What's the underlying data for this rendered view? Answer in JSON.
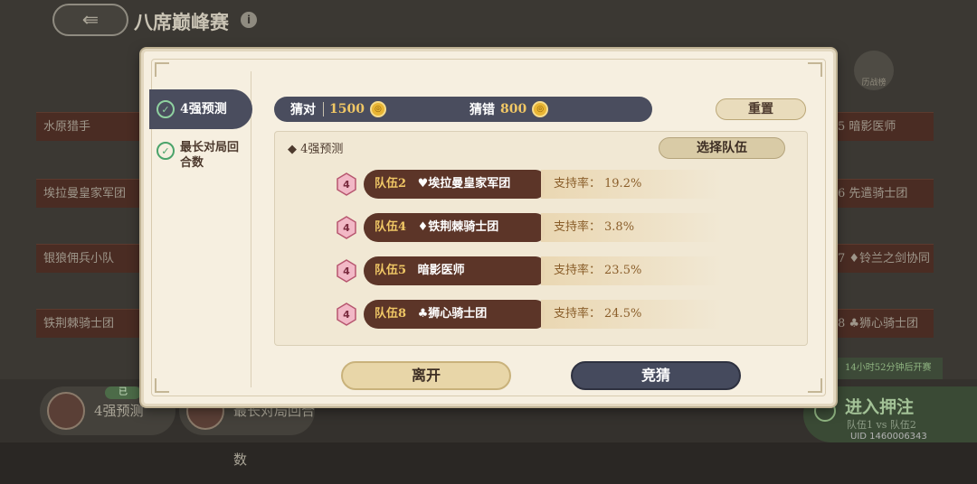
{
  "header": {
    "title": "八席巅峰赛",
    "back_icon": "⇚",
    "info_icon": "i"
  },
  "background": {
    "left_rows": [
      "水原猎手",
      "埃拉曼皇家军团",
      "银狼佣兵小队",
      "铁荆棘骑士团"
    ],
    "right_rows": [
      "5 暗影医师",
      "6 先遣骑士团",
      "7 ♦铃兰之剑协同",
      "8 ♣狮心骑士团"
    ],
    "ribbon_label": "历战榜",
    "countdown": "14小时52分钟后开赛",
    "bottom_tabs": [
      "4强预测",
      "最长对局回合数"
    ],
    "done_badge": "已",
    "enter_bet": {
      "title": "进入押注",
      "match": "队伍1 vs 队伍2"
    },
    "uid": "UID 1460006343"
  },
  "dialog": {
    "sidebar": [
      {
        "label": "4强预测",
        "active": true
      },
      {
        "label": "最长对局回合数",
        "active": false
      }
    ],
    "score": {
      "correct_label": "猜对",
      "correct_value": "1500",
      "wrong_label": "猜错",
      "wrong_value": "800",
      "coin_glyph": "◎"
    },
    "reset_label": "重置",
    "panel_title": "◆ 4强预测",
    "select_team_label": "选择队伍",
    "medal_number": "4",
    "rate_label": "支持率：",
    "teams": [
      {
        "id": "队伍2",
        "name": "♥埃拉曼皇家军团",
        "rate": "19.2%"
      },
      {
        "id": "队伍4",
        "name": "♦铁荆棘骑士团",
        "rate": "3.8%"
      },
      {
        "id": "队伍5",
        "name": "暗影医师",
        "rate": "23.5%"
      },
      {
        "id": "队伍8",
        "name": "♣狮心骑士团",
        "rate": "24.5%"
      }
    ],
    "leave_label": "离开",
    "guess_label": "竞猜"
  },
  "colors": {
    "dialog_bg": "#f6efe0",
    "navy": "#4a4d5e",
    "team_plate": "#5c3528",
    "gold": "#f0c765",
    "rate_text": "#8a5e2a",
    "check_green": "#4aa36a"
  }
}
